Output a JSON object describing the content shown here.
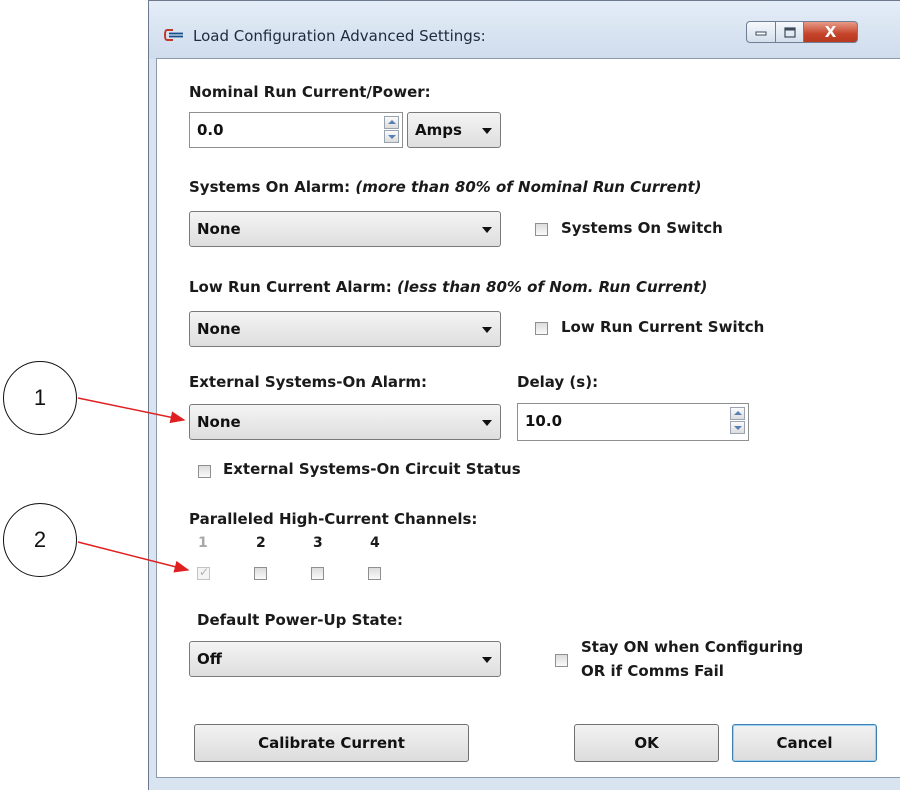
{
  "window": {
    "title": "Load Configuration Advanced Settings:",
    "close_glyph": "X"
  },
  "nominal": {
    "label": "Nominal Run Current/Power:",
    "value": "0.0",
    "unit": "Amps"
  },
  "systems_on": {
    "label": "Systems On Alarm:",
    "note": "(more than 80% of Nominal Run Current)",
    "selected": "None",
    "switch_label": "Systems On Switch",
    "switch_checked": false
  },
  "low_run": {
    "label": "Low Run Current Alarm:",
    "note": "(less than 80% of Nom. Run Current)",
    "selected": "None",
    "switch_label": "Low Run Current Switch",
    "switch_checked": false
  },
  "external": {
    "label": "External Systems-On Alarm:",
    "selected": "None",
    "delay_label": "Delay (s):",
    "delay_value": "10.0",
    "circuit_status_label": "External Systems-On Circuit Status",
    "circuit_status_checked": false
  },
  "paralleled": {
    "label": "Paralleled High-Current Channels:",
    "channels": [
      {
        "number": "1",
        "checked": true,
        "disabled": true
      },
      {
        "number": "2",
        "checked": false,
        "disabled": false
      },
      {
        "number": "3",
        "checked": false,
        "disabled": false
      },
      {
        "number": "4",
        "checked": false,
        "disabled": false
      }
    ]
  },
  "power_up": {
    "label": "Default Power-Up State:",
    "selected": "Off",
    "stay_on_line1": "Stay ON when Configuring",
    "stay_on_line2": "OR if Comms Fail",
    "stay_on_checked": false
  },
  "buttons": {
    "calibrate": "Calibrate Current",
    "ok": "OK",
    "cancel": "Cancel"
  },
  "callouts": [
    {
      "label": "1",
      "target": "external-alarm-combo"
    },
    {
      "label": "2",
      "target": "channel-1-checkbox"
    }
  ],
  "colors": {
    "callout_arrow": "#e02020",
    "close_button": "#c4432a",
    "default_button_border": "#3c7fb1"
  }
}
